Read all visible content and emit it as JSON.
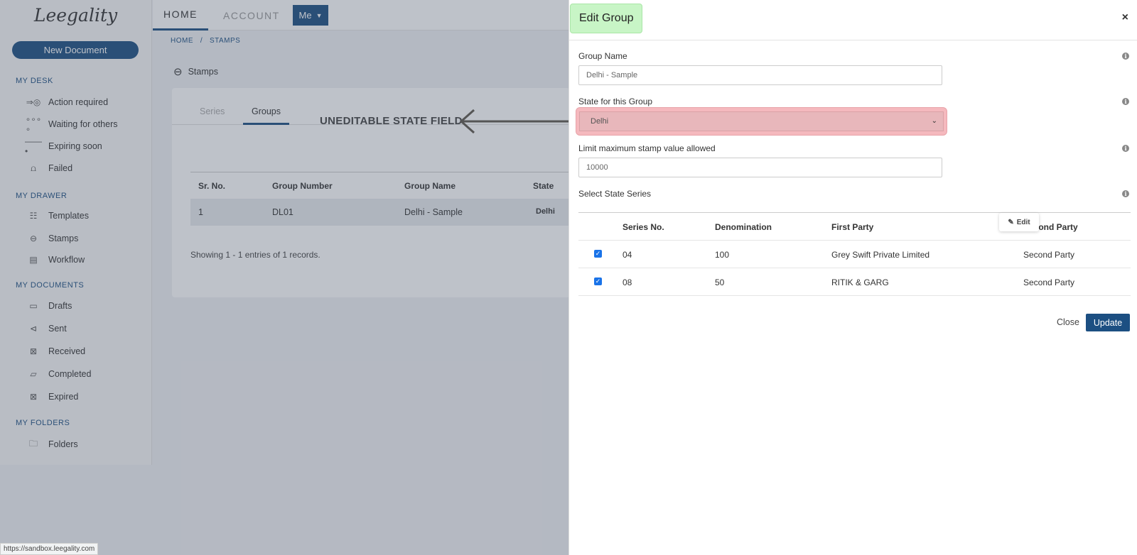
{
  "app": {
    "logo": "Leegality"
  },
  "sidebar": {
    "new_document": "New Document",
    "sections": {
      "my_desk": "MY DESK",
      "my_drawer": "MY DRAWER",
      "my_documents": "MY DOCUMENTS",
      "my_folders": "MY FOLDERS"
    },
    "items": {
      "action_required": "Action required",
      "waiting_for_others": "Waiting for others",
      "expiring_soon": "Expiring soon",
      "failed": "Failed",
      "templates": "Templates",
      "stamps": "Stamps",
      "workflow": "Workflow",
      "drafts": "Drafts",
      "sent": "Sent",
      "received": "Received",
      "completed": "Completed",
      "expired": "Expired",
      "folders": "Folders"
    }
  },
  "topbar": {
    "home": "HOME",
    "account": "ACCOUNT",
    "me": "Me"
  },
  "breadcrumb": {
    "home": "HOME",
    "sep": "/",
    "current": "STAMPS"
  },
  "page": {
    "title": "Stamps"
  },
  "tabs": {
    "series": "Series",
    "groups": "Groups"
  },
  "annotation": "UNEDITABLE STATE FIELD",
  "groups_table": {
    "headers": {
      "sr": "Sr. No.",
      "number": "Group Number",
      "name": "Group Name",
      "state": "State"
    },
    "rows": [
      {
        "sr": "1",
        "number": "DL01",
        "name": "Delhi - Sample",
        "state": "Delhi"
      }
    ],
    "showing": "Showing 1 - 1 entries of 1 records."
  },
  "modal": {
    "title": "Edit Group",
    "close_x": "×",
    "group_name_label": "Group Name",
    "group_name_value": "Delhi - Sample",
    "state_label": "State for this Group",
    "state_value": "Delhi",
    "limit_label": "Limit maximum stamp value allowed",
    "limit_value": "10000",
    "series_label": "Select State Series",
    "series_headers": {
      "no": "Series No.",
      "denomination": "Denomination",
      "first": "First Party",
      "second": "Second Party"
    },
    "series_rows": [
      {
        "no": "04",
        "denomination": "100",
        "first": "Grey Swift Private Limited",
        "second": "Second Party",
        "checked": true
      },
      {
        "no": "08",
        "denomination": "50",
        "first": "RITIK & GARG",
        "second": "Second Party",
        "checked": true
      }
    ],
    "edit_tooltip": "Edit",
    "close_button": "Close",
    "update_button": "Update"
  },
  "status_url": "https://sandbox.leegality.com",
  "colors": {
    "primary": "#1c4f82",
    "highlight_green": "#c8f5c6",
    "highlight_red": "#f5b9be"
  }
}
